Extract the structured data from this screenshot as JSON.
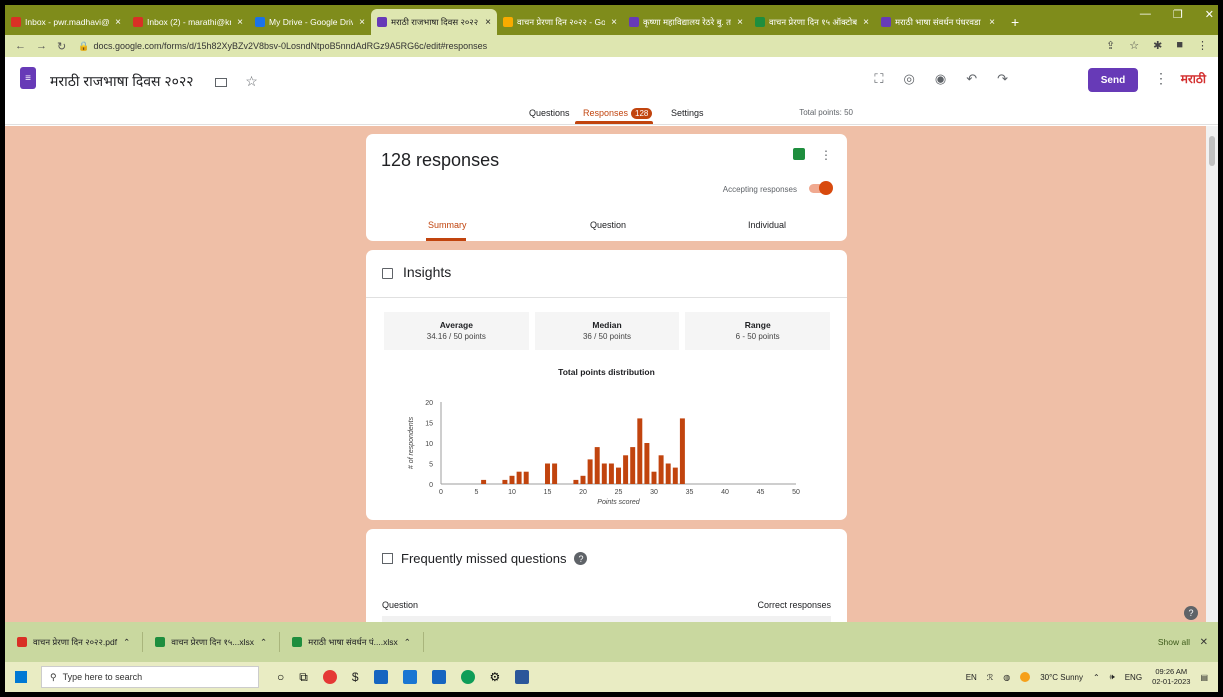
{
  "browser": {
    "tabs": [
      {
        "label": "Inbox - pwr.madhavi@gm",
        "color": "#d93025",
        "active": false
      },
      {
        "label": "Inbox (2) - marathi@krish",
        "color": "#d93025",
        "active": false
      },
      {
        "label": "My Drive - Google Drive",
        "color": "#1a73e8",
        "active": false
      },
      {
        "label": "मराठी राजभाषा दिवस २०२२",
        "color": "#673ab7",
        "active": true
      },
      {
        "label": "वाचन प्रेरणा दिन २०२२ - Goo",
        "color": "#f9ab00",
        "active": false
      },
      {
        "label": "कृष्णा महाविद्यालय रेठरे बु. ता",
        "color": "#673ab7",
        "active": false
      },
      {
        "label": "वाचन प्रेरणा दिन १५ ऑक्टोबर",
        "color": "#1e8e3e",
        "active": false
      },
      {
        "label": "मराठी भाषा संवर्धन पंधरवडा",
        "color": "#673ab7",
        "active": false
      }
    ],
    "new_tab": "+",
    "url": "docs.google.com/forms/d/15h82XyBZv2V8bsv-0LosndNtpoB5nndAdRGz9A5RG6c/edit#responses"
  },
  "form": {
    "title": "मराठी राजभाषा दिवस २०२२",
    "send_label": "Send",
    "brand": "मराठी",
    "tabs": {
      "questions": "Questions",
      "responses": "Responses",
      "responses_count": "128",
      "settings": "Settings"
    },
    "total_points": "Total points: 50"
  },
  "responses": {
    "count_title": "128 responses",
    "accepting": "Accepting responses",
    "subtabs": {
      "summary": "Summary",
      "question": "Question",
      "individual": "Individual"
    }
  },
  "insights": {
    "title": "Insights",
    "average": {
      "label": "Average",
      "value": "34.16 / 50 points"
    },
    "median": {
      "label": "Median",
      "value": "36 / 50 points"
    },
    "range": {
      "label": "Range",
      "value": "6 - 50 points"
    },
    "chart_title": "Total points distribution"
  },
  "chart_data": {
    "type": "bar",
    "title": "Total points distribution",
    "xlabel": "Points scored",
    "ylabel": "# of respondents",
    "xlim": [
      0,
      50
    ],
    "ylim": [
      0,
      20
    ],
    "xticks": [
      0,
      5,
      10,
      15,
      20,
      25,
      30,
      35,
      40,
      45,
      50
    ],
    "yticks": [
      0,
      5,
      10,
      15,
      20
    ],
    "bar_color": "#c1440e",
    "x": [
      6,
      9,
      10,
      11,
      12,
      13,
      14,
      15,
      16,
      17,
      18,
      19,
      20,
      21,
      22,
      23,
      24,
      25,
      26,
      27,
      28,
      29,
      30,
      31,
      32,
      33,
      34,
      35,
      36,
      37,
      38,
      39,
      40,
      41,
      42,
      43,
      44,
      45,
      46,
      47,
      48,
      49,
      50
    ],
    "values": [
      1,
      1,
      2,
      3,
      3,
      0,
      0,
      5,
      5,
      0,
      0,
      1,
      2,
      6,
      9,
      5,
      5,
      4,
      7,
      9,
      16,
      10,
      3,
      7,
      5,
      4,
      16,
      0,
      0,
      0,
      0,
      0,
      0,
      0,
      0,
      0,
      0,
      0,
      0,
      0,
      0,
      0,
      0
    ]
  },
  "missed": {
    "title": "Frequently missed questions",
    "question_header": "Question",
    "correct_header": "Correct responses"
  },
  "downloads": {
    "items": [
      "वाचन प्रेरणा दिन २०२२.pdf",
      "वाचन प्रेरणा दिन १५...xlsx",
      "मराठी भाषा संवर्धन पं....xlsx"
    ],
    "show_all": "Show all"
  },
  "taskbar": {
    "search_placeholder": "Type here to search",
    "lang": "EN",
    "weather": "30°C Sunny",
    "ime": "ENG",
    "time": "09:26 AM",
    "date": "02-01-2023"
  }
}
